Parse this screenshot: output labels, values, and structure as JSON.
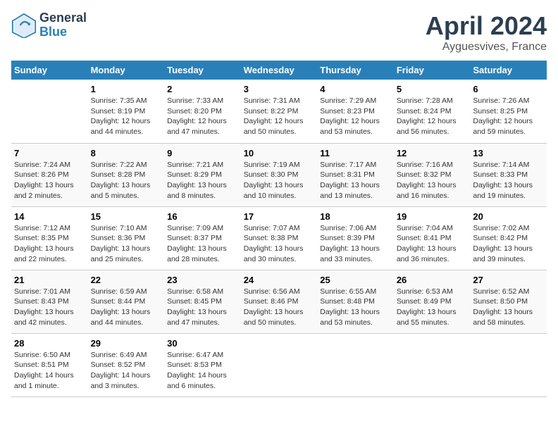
{
  "header": {
    "logo_general": "General",
    "logo_blue": "Blue",
    "month_title": "April 2024",
    "location": "Ayguesvives, France"
  },
  "days_of_week": [
    "Sunday",
    "Monday",
    "Tuesday",
    "Wednesday",
    "Thursday",
    "Friday",
    "Saturday"
  ],
  "weeks": [
    [
      {
        "num": "",
        "detail": ""
      },
      {
        "num": "1",
        "detail": "Sunrise: 7:35 AM\nSunset: 8:19 PM\nDaylight: 12 hours\nand 44 minutes."
      },
      {
        "num": "2",
        "detail": "Sunrise: 7:33 AM\nSunset: 8:20 PM\nDaylight: 12 hours\nand 47 minutes."
      },
      {
        "num": "3",
        "detail": "Sunrise: 7:31 AM\nSunset: 8:22 PM\nDaylight: 12 hours\nand 50 minutes."
      },
      {
        "num": "4",
        "detail": "Sunrise: 7:29 AM\nSunset: 8:23 PM\nDaylight: 12 hours\nand 53 minutes."
      },
      {
        "num": "5",
        "detail": "Sunrise: 7:28 AM\nSunset: 8:24 PM\nDaylight: 12 hours\nand 56 minutes."
      },
      {
        "num": "6",
        "detail": "Sunrise: 7:26 AM\nSunset: 8:25 PM\nDaylight: 12 hours\nand 59 minutes."
      }
    ],
    [
      {
        "num": "7",
        "detail": "Sunrise: 7:24 AM\nSunset: 8:26 PM\nDaylight: 13 hours\nand 2 minutes."
      },
      {
        "num": "8",
        "detail": "Sunrise: 7:22 AM\nSunset: 8:28 PM\nDaylight: 13 hours\nand 5 minutes."
      },
      {
        "num": "9",
        "detail": "Sunrise: 7:21 AM\nSunset: 8:29 PM\nDaylight: 13 hours\nand 8 minutes."
      },
      {
        "num": "10",
        "detail": "Sunrise: 7:19 AM\nSunset: 8:30 PM\nDaylight: 13 hours\nand 10 minutes."
      },
      {
        "num": "11",
        "detail": "Sunrise: 7:17 AM\nSunset: 8:31 PM\nDaylight: 13 hours\nand 13 minutes."
      },
      {
        "num": "12",
        "detail": "Sunrise: 7:16 AM\nSunset: 8:32 PM\nDaylight: 13 hours\nand 16 minutes."
      },
      {
        "num": "13",
        "detail": "Sunrise: 7:14 AM\nSunset: 8:33 PM\nDaylight: 13 hours\nand 19 minutes."
      }
    ],
    [
      {
        "num": "14",
        "detail": "Sunrise: 7:12 AM\nSunset: 8:35 PM\nDaylight: 13 hours\nand 22 minutes."
      },
      {
        "num": "15",
        "detail": "Sunrise: 7:10 AM\nSunset: 8:36 PM\nDaylight: 13 hours\nand 25 minutes."
      },
      {
        "num": "16",
        "detail": "Sunrise: 7:09 AM\nSunset: 8:37 PM\nDaylight: 13 hours\nand 28 minutes."
      },
      {
        "num": "17",
        "detail": "Sunrise: 7:07 AM\nSunset: 8:38 PM\nDaylight: 13 hours\nand 30 minutes."
      },
      {
        "num": "18",
        "detail": "Sunrise: 7:06 AM\nSunset: 8:39 PM\nDaylight: 13 hours\nand 33 minutes."
      },
      {
        "num": "19",
        "detail": "Sunrise: 7:04 AM\nSunset: 8:41 PM\nDaylight: 13 hours\nand 36 minutes."
      },
      {
        "num": "20",
        "detail": "Sunrise: 7:02 AM\nSunset: 8:42 PM\nDaylight: 13 hours\nand 39 minutes."
      }
    ],
    [
      {
        "num": "21",
        "detail": "Sunrise: 7:01 AM\nSunset: 8:43 PM\nDaylight: 13 hours\nand 42 minutes."
      },
      {
        "num": "22",
        "detail": "Sunrise: 6:59 AM\nSunset: 8:44 PM\nDaylight: 13 hours\nand 44 minutes."
      },
      {
        "num": "23",
        "detail": "Sunrise: 6:58 AM\nSunset: 8:45 PM\nDaylight: 13 hours\nand 47 minutes."
      },
      {
        "num": "24",
        "detail": "Sunrise: 6:56 AM\nSunset: 8:46 PM\nDaylight: 13 hours\nand 50 minutes."
      },
      {
        "num": "25",
        "detail": "Sunrise: 6:55 AM\nSunset: 8:48 PM\nDaylight: 13 hours\nand 53 minutes."
      },
      {
        "num": "26",
        "detail": "Sunrise: 6:53 AM\nSunset: 8:49 PM\nDaylight: 13 hours\nand 55 minutes."
      },
      {
        "num": "27",
        "detail": "Sunrise: 6:52 AM\nSunset: 8:50 PM\nDaylight: 13 hours\nand 58 minutes."
      }
    ],
    [
      {
        "num": "28",
        "detail": "Sunrise: 6:50 AM\nSunset: 8:51 PM\nDaylight: 14 hours\nand 1 minute."
      },
      {
        "num": "29",
        "detail": "Sunrise: 6:49 AM\nSunset: 8:52 PM\nDaylight: 14 hours\nand 3 minutes."
      },
      {
        "num": "30",
        "detail": "Sunrise: 6:47 AM\nSunset: 8:53 PM\nDaylight: 14 hours\nand 6 minutes."
      },
      {
        "num": "",
        "detail": ""
      },
      {
        "num": "",
        "detail": ""
      },
      {
        "num": "",
        "detail": ""
      },
      {
        "num": "",
        "detail": ""
      }
    ]
  ]
}
